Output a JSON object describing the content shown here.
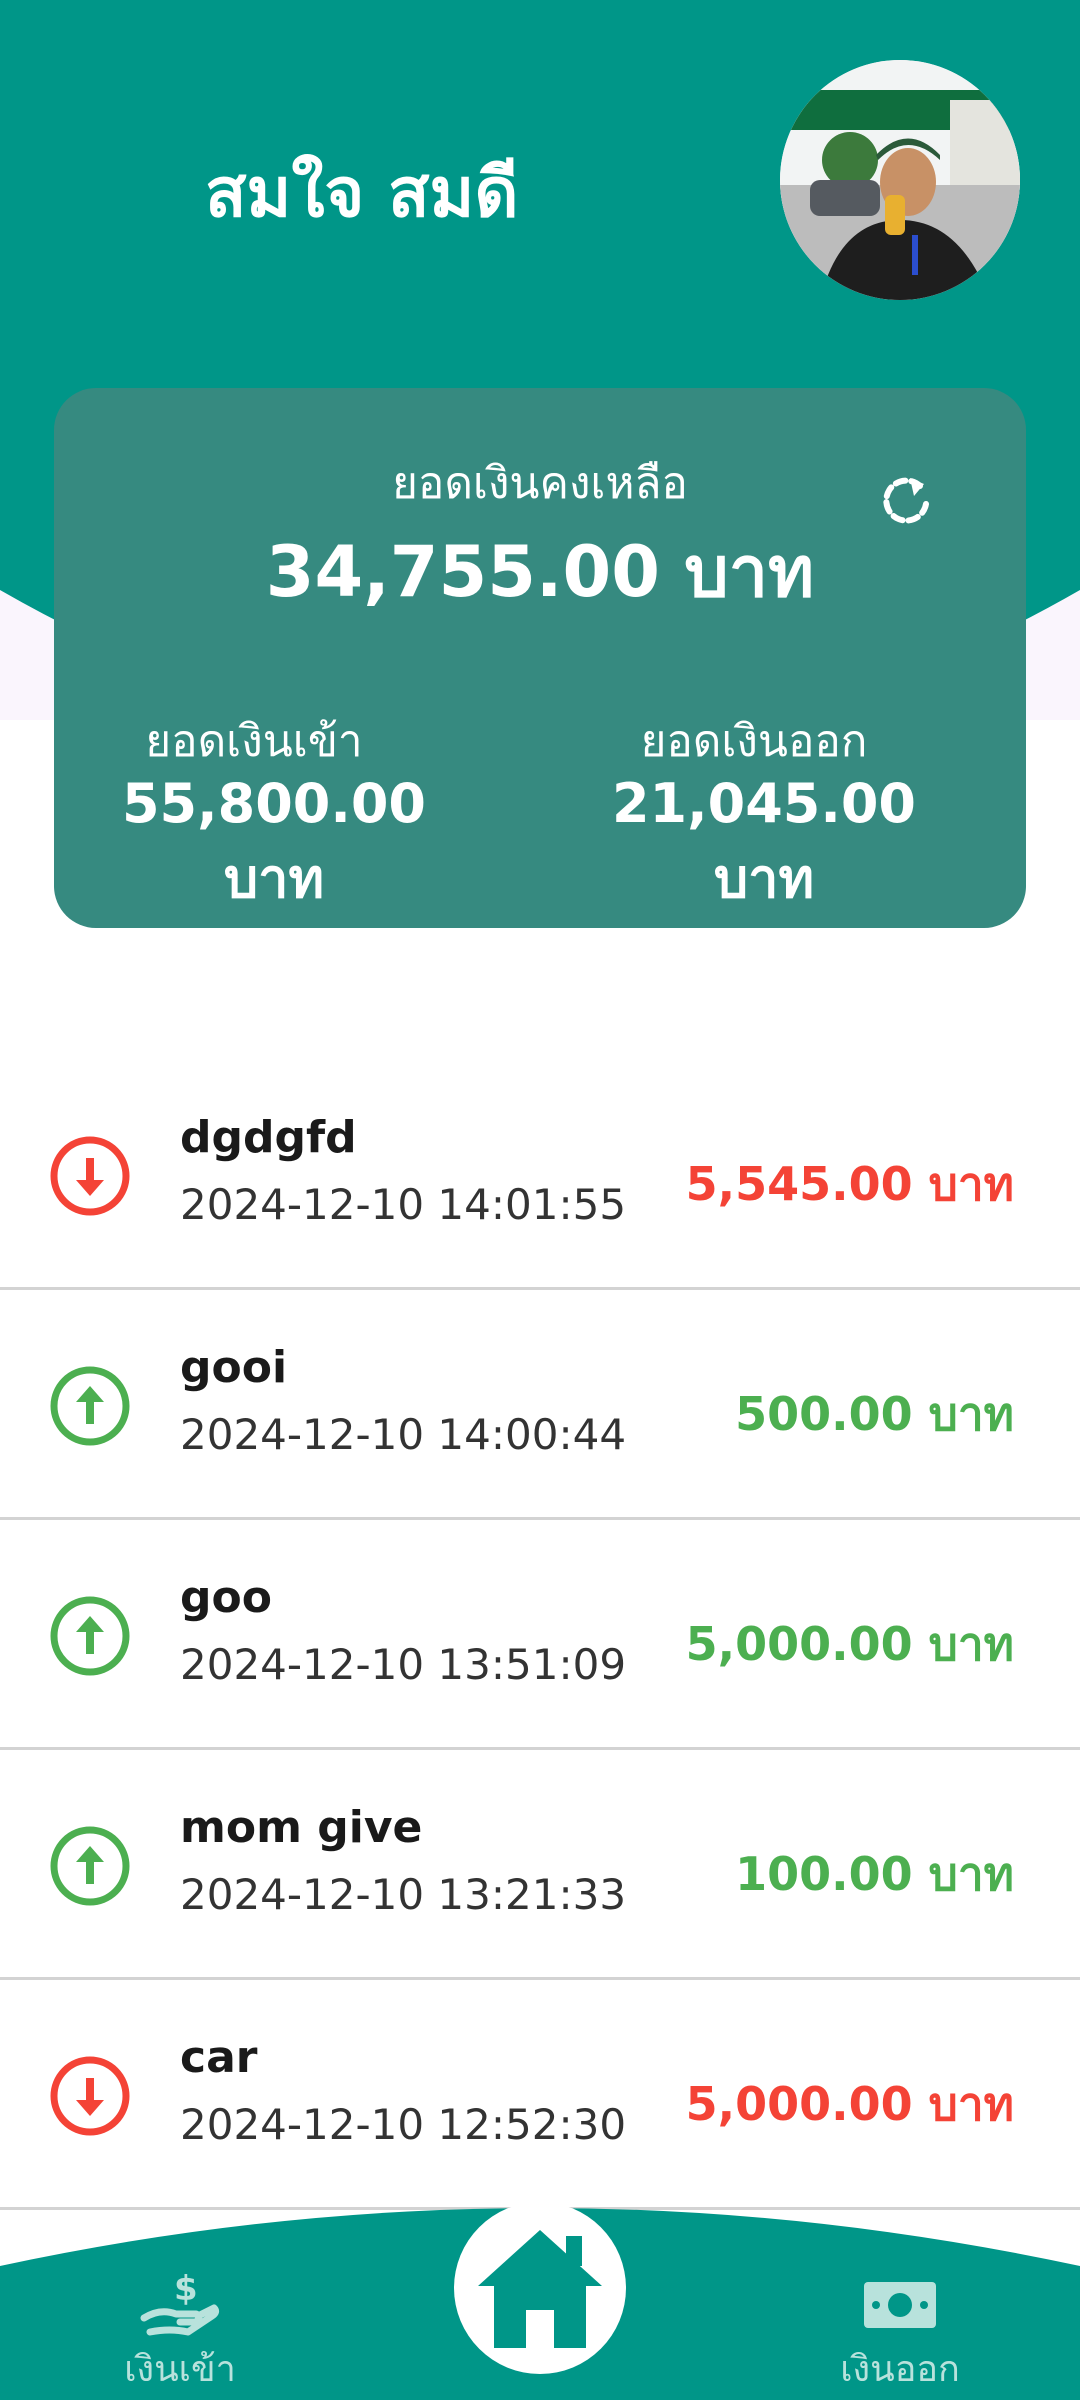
{
  "user": {
    "name": "สมใจ สมดี",
    "avatar": "profile-photo"
  },
  "summary": {
    "balance_label": "ยอดเงินคงเหลือ",
    "balance_amount": "34,755.00 บาท",
    "income_label": "ยอดเงินเข้า",
    "income_amount": "55,800.00 บาท",
    "expense_label": "ยอดเงินออก",
    "expense_amount": "21,045.00 บาท",
    "refresh_icon": "refresh-icon"
  },
  "transactions": [
    {
      "title": "dgdgfd",
      "time": "2024-12-10 14:01:55",
      "amount": "5,545.00 บาท",
      "type": "expense"
    },
    {
      "title": "gooi",
      "time": "2024-12-10 14:00:44",
      "amount": "500.00 บาท",
      "type": "income"
    },
    {
      "title": "goo",
      "time": "2024-12-10 13:51:09",
      "amount": "5,000.00 บาท",
      "type": "income"
    },
    {
      "title": "mom give",
      "time": "2024-12-10 13:21:33",
      "amount": "100.00 บาท",
      "type": "income"
    },
    {
      "title": "car",
      "time": "2024-12-10 12:52:30",
      "amount": "5,000.00 บาท",
      "type": "expense"
    }
  ],
  "nav": {
    "income_label": "เงินเข้า",
    "expense_label": "เงินออก",
    "home_icon": "home-icon"
  },
  "colors": {
    "primary": "#009688",
    "card": "#368a80",
    "income": "#4caf50",
    "expense": "#f44336"
  }
}
